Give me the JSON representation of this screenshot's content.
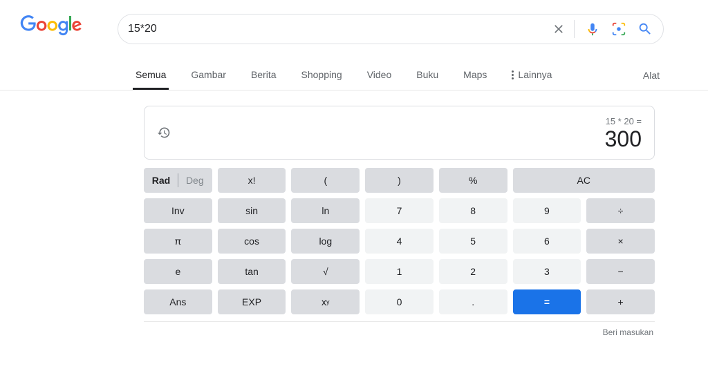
{
  "search": {
    "query": "15*20"
  },
  "tabs": {
    "all": "Semua",
    "images": "Gambar",
    "news": "Berita",
    "shopping": "Shopping",
    "video": "Video",
    "books": "Buku",
    "maps": "Maps",
    "more": "Lainnya",
    "tools": "Alat"
  },
  "calculator": {
    "expression": "15 * 20 =",
    "result": "300",
    "buttons": {
      "rad": "Rad",
      "deg": "Deg",
      "factorial": "x!",
      "lparen": "(",
      "rparen": ")",
      "percent": "%",
      "ac": "AC",
      "inv": "Inv",
      "sin": "sin",
      "ln": "ln",
      "n7": "7",
      "n8": "8",
      "n9": "9",
      "divide": "÷",
      "pi": "π",
      "cos": "cos",
      "log": "log",
      "n4": "4",
      "n5": "5",
      "n6": "6",
      "multiply": "×",
      "e": "e",
      "tan": "tan",
      "sqrt": "√",
      "n1": "1",
      "n2": "2",
      "n3": "3",
      "minus": "−",
      "ans": "Ans",
      "exp": "EXP",
      "dot": ".",
      "n0": "0",
      "equals": "=",
      "plus": "+"
    }
  },
  "feedback": "Beri masukan"
}
